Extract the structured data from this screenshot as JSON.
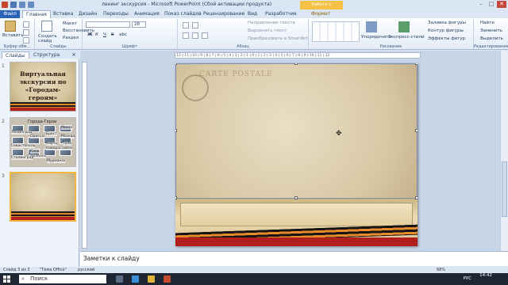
{
  "window": {
    "title": "ленинг экскурсия  -  Microsoft PowerPoint (Сбой активации продукта)",
    "context_tab": "Работа с рисунками",
    "minimize": "–",
    "maximize": "□",
    "close": "✕"
  },
  "ribbon_tabs": {
    "file": "Файл",
    "home": "Главная",
    "insert": "Вставка",
    "design": "Дизайн",
    "transitions": "Переходы",
    "animation": "Анимация",
    "slideshow": "Показ слайдов",
    "review": "Рецензирование",
    "view": "Вид",
    "developer": "Разработчик",
    "format": "Формат"
  },
  "ribbon": {
    "clipboard": {
      "paste": "Вставить",
      "label": "Буфер обм..."
    },
    "slides": {
      "new_slide": "Создать слайд",
      "layout": "Макет",
      "reset": "Восстановить",
      "section": "Раздел",
      "label": "Слайды"
    },
    "font": {
      "size": "28",
      "bold": "Ж",
      "italic": "К",
      "underline": "Ч",
      "strike": "S",
      "spacing": "abc",
      "label": "Шрифт"
    },
    "paragraph": {
      "text_direction": "Направление текста",
      "align_text": "Выровнять текст",
      "smartart": "Преобразовать в SmartArt",
      "label": "Абзац"
    },
    "drawing": {
      "arrange": "Упорядочить",
      "quick_styles": "Экспресс-стили",
      "label": "Рисование",
      "fill": "Заливка фигуры",
      "outline": "Контур фигуры",
      "effects": "Эффекты фигур"
    },
    "editing": {
      "find": "Найти",
      "replace": "Заменить",
      "select": "Выделить",
      "label": "Редактирование"
    }
  },
  "panel": {
    "tab_slides": "Слайды",
    "tab_outline": "Структура",
    "close": "×",
    "slides": [
      {
        "num": "1",
        "title": "Виртуальная экскурсия по «Городам-героям»"
      },
      {
        "num": "2",
        "title": "Города-Герои",
        "cities": [
          "Ленинград",
          "Одесса",
          "Брест",
          "Минск",
          "Севастополь",
          "Керчь",
          "Тула",
          "Новороссийск",
          "Смоленск",
          "Москва",
          "Сталинград",
          "Киев",
          "Мурманск"
        ]
      },
      {
        "num": "3"
      }
    ]
  },
  "ruler": {
    "text": "·12·|·11·|·10·|·9·|·8·|·7·|·6·|·5·|·4·|·3·|·2·|·1·|·0·|·1·|·2·|·3·|·4·|·5·|·6·|·7·|·8·|·9·|·10·|·11·|·12·"
  },
  "slide_canvas": {
    "watermark": "CARTE POSTALE"
  },
  "notes": {
    "placeholder": "Заметки к слайду"
  },
  "status": {
    "slide": "Слайд 3 из 3",
    "theme": "\"Тема Office\"",
    "lang": "русский",
    "zoom": "68%"
  },
  "taskbar": {
    "search": "Поиск",
    "lang": "РУС",
    "time": "14:42"
  }
}
